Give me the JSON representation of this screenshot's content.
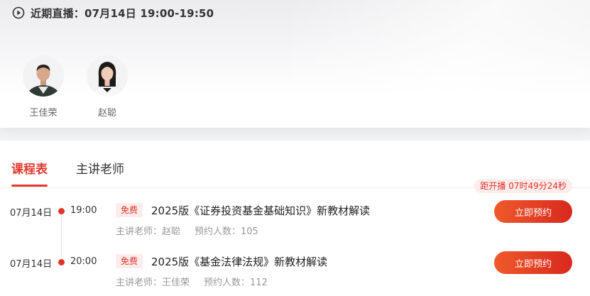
{
  "live": {
    "label": "近期直播：07月14日 19:00-19:50",
    "icon": "play-circle-icon"
  },
  "teachers": [
    {
      "name": "王佳荣"
    },
    {
      "name": "赵聪"
    }
  ],
  "tabs": [
    {
      "label": "课程表",
      "active": true
    },
    {
      "label": "主讲老师",
      "active": false
    }
  ],
  "countdown": "距开播 07时49分24秒",
  "courses": [
    {
      "date": "07月14日",
      "time": "19:00",
      "tag": "免费",
      "title": "2025版《证券投资基金基础知识》新教材解读",
      "teacher_label": "主讲老师：赵聪",
      "booked_label": "预约人数：105",
      "button": "立即预约"
    },
    {
      "date": "07月14日",
      "time": "20:00",
      "tag": "免费",
      "title": "2025版《基金法律法规》新教材解读",
      "teacher_label": "主讲老师：王佳荣",
      "booked_label": "预约人数：112",
      "button": "立即预约"
    }
  ],
  "colors": {
    "accent": "#e0332a",
    "tag_bg": "#fdecec"
  }
}
